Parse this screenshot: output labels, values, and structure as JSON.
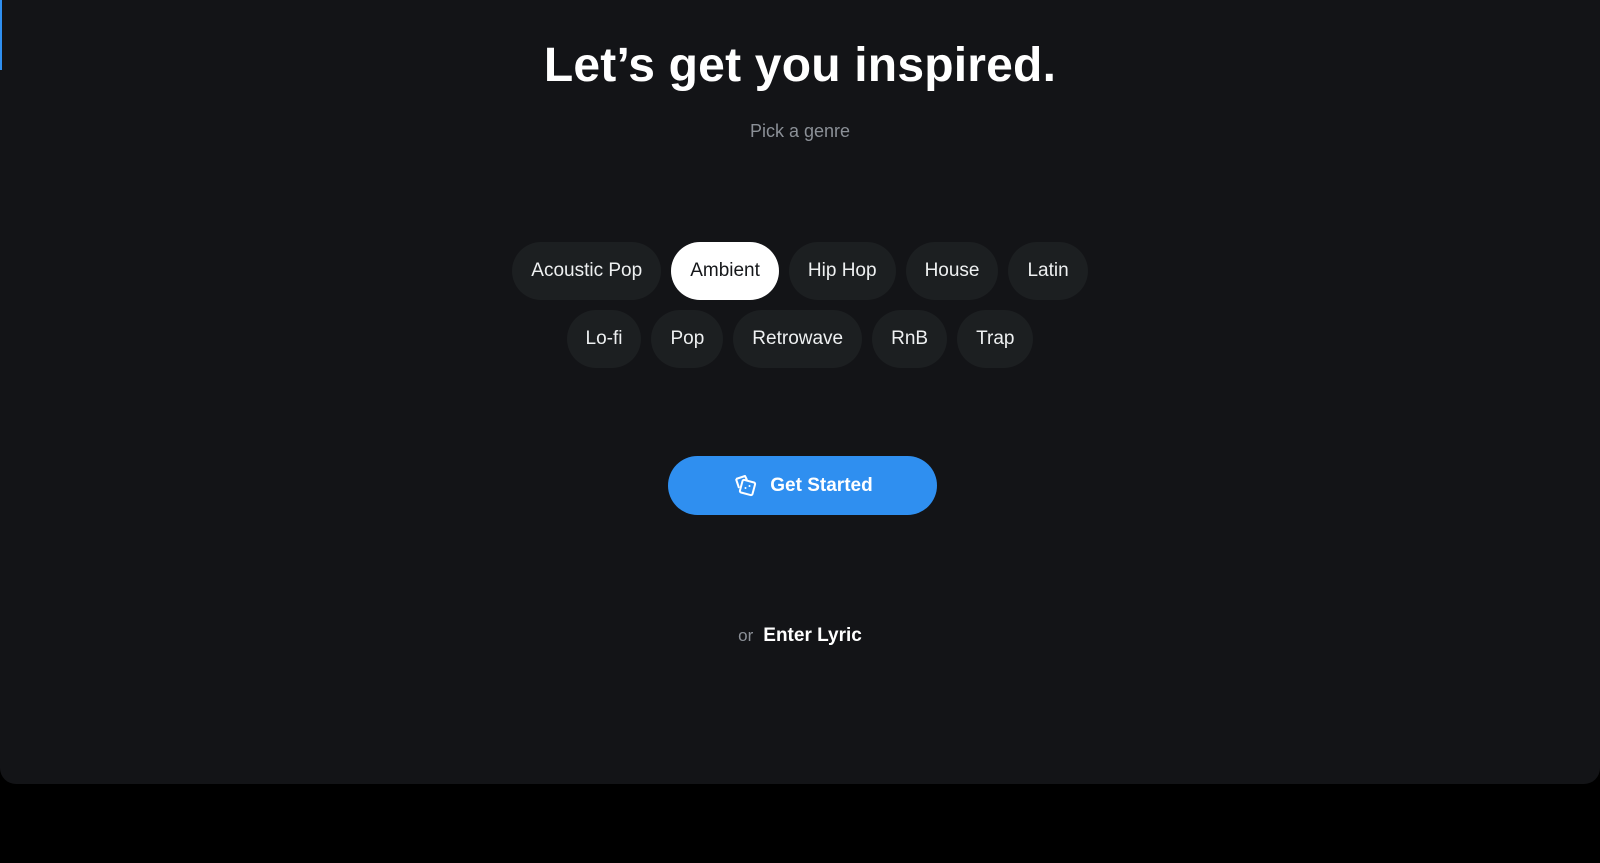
{
  "header": {
    "title": "Let’s get you inspired.",
    "subtitle": "Pick a genre"
  },
  "genres": {
    "row1": [
      {
        "label": "Acoustic Pop",
        "selected": false
      },
      {
        "label": "Ambient",
        "selected": true
      },
      {
        "label": "Hip Hop",
        "selected": false
      },
      {
        "label": "House",
        "selected": false
      },
      {
        "label": "Latin",
        "selected": false
      }
    ],
    "row2": [
      {
        "label": "Lo-fi",
        "selected": false
      },
      {
        "label": "Pop",
        "selected": false
      },
      {
        "label": "Retrowave",
        "selected": false
      },
      {
        "label": "RnB",
        "selected": false
      },
      {
        "label": "Trap",
        "selected": false
      }
    ],
    "selected": "Ambient"
  },
  "cta": {
    "icon": "dice-icon",
    "label": "Get Started"
  },
  "alternative": {
    "prefix": "or",
    "link_label": "Enter Lyric"
  },
  "colors": {
    "background": "#131417",
    "accent": "#2f8ff0",
    "pill": "#1c1f21",
    "pill_selected": "#ffffff",
    "muted_text": "#8b9097"
  }
}
